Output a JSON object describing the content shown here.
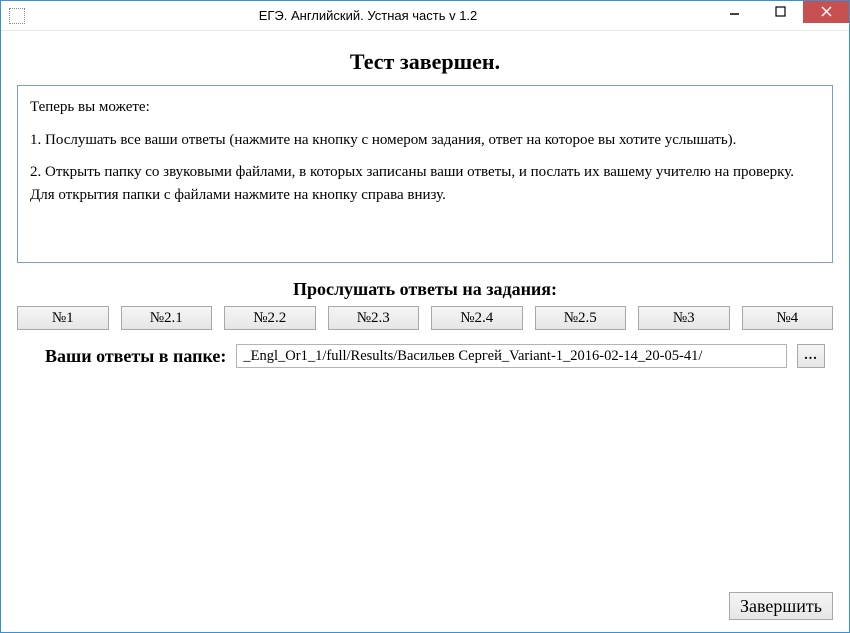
{
  "titlebar": {
    "title": "ЕГЭ. Английский. Устная часть v 1.2"
  },
  "heading": "Тест завершен.",
  "info": {
    "intro": "Теперь вы можете:",
    "line1": "1. Послушать все ваши ответы (нажмите на кнопку с номером задания, ответ на которое вы хотите услышать).",
    "line2": "2. Открыть папку со звуковыми файлами, в которых записаны ваши ответы, и послать их вашему учителю на проверку. Для открытия папки с файлами нажмите на кнопку справа внизу."
  },
  "listen_label": "Прослушать ответы на задания:",
  "task_buttons": {
    "b1": "№1",
    "b2": "№2.1",
    "b3": "№2.2",
    "b4": "№2.3",
    "b5": "№2.4",
    "b6": "№2.5",
    "b7": "№3",
    "b8": "№4"
  },
  "folder": {
    "label": "Ваши ответы в папке:",
    "path": "_Engl_Or1_1/full/Results/Васильев Сергей_Variant-1_2016-02-14_20-05-41/",
    "browse": "..."
  },
  "finish_label": "Завершить"
}
